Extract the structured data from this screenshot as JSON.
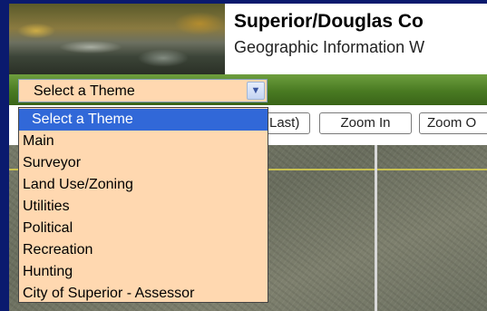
{
  "header": {
    "title": "Superior/Douglas Co",
    "subtitle": "Geographic Information W"
  },
  "theme_select": {
    "selected": "Select a Theme",
    "options": [
      "Select a Theme",
      "Main",
      "Surveyor",
      "Land Use/Zoning",
      "Utilities",
      "Political",
      "Recreation",
      "Hunting",
      "City of Superior - Assessor"
    ]
  },
  "toolbar": {
    "last_label": "Last)",
    "zoom_in_label": "Zoom In",
    "zoom_out_label": "Zoom O"
  },
  "colors": {
    "page_background": "#0a1a6e",
    "header_green": "#497a22",
    "dropdown_background": "#ffd8b0",
    "highlight": "#3168d8"
  },
  "icons": {
    "dropdown_arrow": "chevron-down-icon"
  }
}
